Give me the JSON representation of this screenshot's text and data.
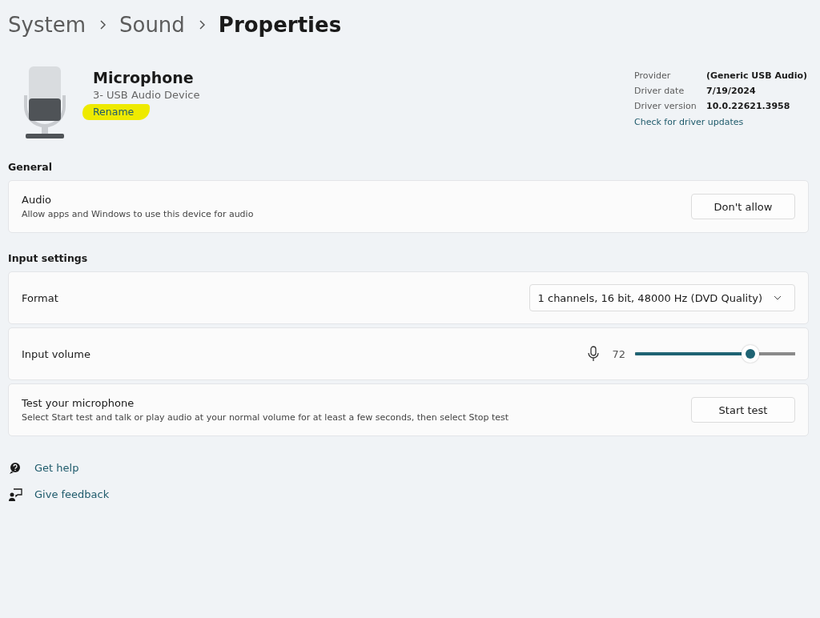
{
  "breadcrumb": [
    "System",
    "Sound",
    "Properties"
  ],
  "device": {
    "name": "Microphone",
    "subtitle": "3- USB Audio Device",
    "rename": {
      "label": "Rename",
      "highlighted": true
    }
  },
  "driver": {
    "rows": [
      {
        "label": "Provider",
        "value": "(Generic USB Audio)"
      },
      {
        "label": "Driver date",
        "value": "7/19/2024"
      },
      {
        "label": "Driver version",
        "value": "10.0.22621.3958"
      }
    ],
    "link": "Check for driver updates"
  },
  "sections": [
    {
      "title": "General",
      "cards": [
        {
          "kind": "button",
          "title": "Audio",
          "description": "Allow apps and Windows to use this device for audio",
          "button": "Don't allow"
        }
      ]
    },
    {
      "title": "Input settings",
      "cards": [
        {
          "kind": "dropdown",
          "title": "Format",
          "value": "1 channels, 16 bit, 48000 Hz (DVD Quality)"
        },
        {
          "kind": "slider",
          "title": "Input volume",
          "reading": "72",
          "level": 0.72
        },
        {
          "kind": "button",
          "title": "Test your microphone",
          "description": "Select Start test and talk or play audio at your normal volume for at least a few seconds, then select Stop test",
          "button": "Start test"
        }
      ]
    }
  ],
  "footer_links": [
    {
      "kind": "help",
      "label": "Get help"
    },
    {
      "kind": "feedback",
      "label": "Give feedback"
    }
  ]
}
